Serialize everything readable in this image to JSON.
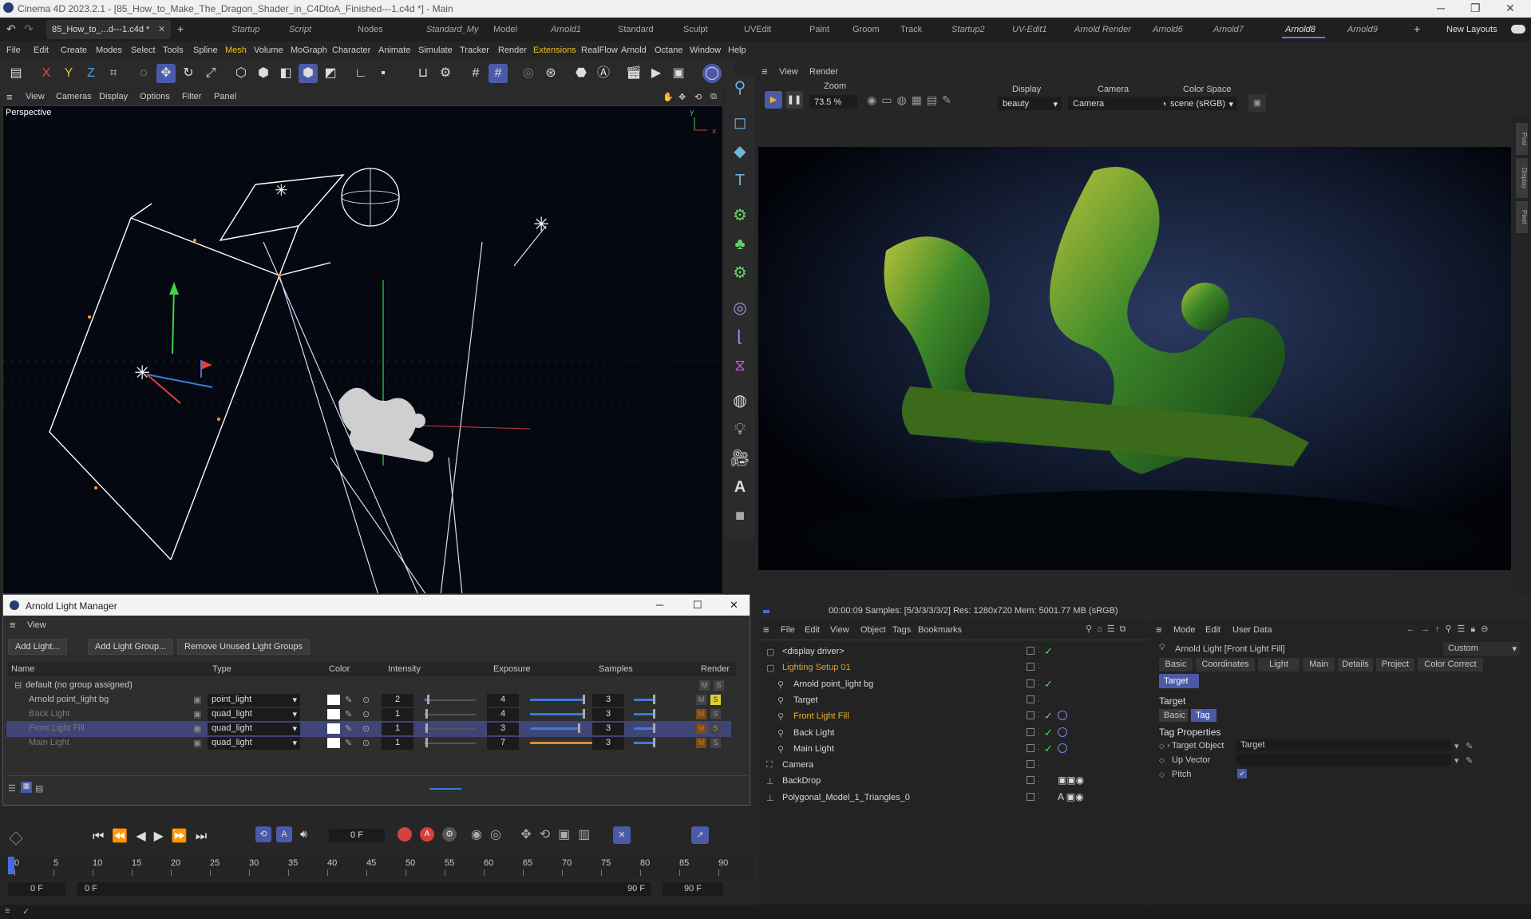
{
  "window": {
    "title": "Cinema 4D 2023.2.1 - [85_How_to_Make_The_Dragon_Shader_in_C4DtoA_Finished---1.c4d *] - Main"
  },
  "tabs": {
    "doc": "85_How_to_...d---1.c4d *",
    "add": "+",
    "layouts": [
      "Startup",
      "Script",
      "Nodes",
      "Standard_My",
      "Model",
      "Arnold1",
      "Standard",
      "Sculpt",
      "UVEdit",
      "Paint",
      "Groom",
      "Track",
      "Startup2",
      "UV-Edit1",
      "Arnold Render",
      "Arnold6",
      "Arnold7",
      "Arnold8",
      "Arnold9"
    ],
    "new_layouts": "New Layouts"
  },
  "menu": [
    "File",
    "Edit",
    "Create",
    "Modes",
    "Select",
    "Tools",
    "Spline",
    "Mesh",
    "Volume",
    "MoGraph",
    "Character",
    "Animate",
    "Simulate",
    "Tracker",
    "Render",
    "Extensions",
    "RealFlow",
    "Arnold",
    "Octane",
    "Window",
    "Help"
  ],
  "viewport_menu": [
    "View",
    "Cameras",
    "Display",
    "Options",
    "Filter",
    "Panel"
  ],
  "viewport": {
    "label": "Perspective"
  },
  "render": {
    "menu": [
      "View",
      "Render"
    ],
    "zoom_label": "Zoom",
    "zoom_value": "73.5 %",
    "display_label": "Display",
    "display_value": "beauty",
    "camera_label": "Camera",
    "camera_value": "Camera",
    "colorspace_label": "Color Space",
    "colorspace_value": "scene (sRGB)",
    "status": "00:00:09  Samples: [5/3/3/3/3/2]  Res: 1280x720  Mem: 5001.77 MB  (sRGB)",
    "side_tabs": [
      "Post",
      "Display",
      "Pixel"
    ]
  },
  "light_manager": {
    "title": "Arnold Light Manager",
    "view": "View",
    "buttons": [
      "Add Light...",
      "Add Light Group...",
      "Remove Unused Light Groups"
    ],
    "columns": [
      "Name",
      "Type",
      "Color",
      "Intensity",
      "Exposure",
      "Samples",
      "Render"
    ],
    "group": "default (no group assigned)",
    "rows": [
      {
        "name": "Arnold point_light bg",
        "type": "point_light",
        "intensity": "2",
        "exposure": "4",
        "samples": "3",
        "expfill": 0.55,
        "intfill": 0.05
      },
      {
        "name": "Back Light",
        "type": "quad_light",
        "intensity": "1",
        "exposure": "4",
        "samples": "3",
        "expfill": 0.55,
        "intfill": 0.02
      },
      {
        "name": "Front Light Fill",
        "type": "quad_light",
        "intensity": "1",
        "exposure": "3",
        "samples": "3",
        "expfill": 0.5,
        "intfill": 0.02
      },
      {
        "name": "Main Light",
        "type": "quad_light",
        "intensity": "1",
        "exposure": "7",
        "samples": "3",
        "expfill": 0.65,
        "intfill": 0.02
      }
    ],
    "m": "M",
    "s": "S"
  },
  "timeline": {
    "frame": "0 F",
    "ticks": [
      "0",
      "5",
      "10",
      "15",
      "20",
      "25",
      "30",
      "35",
      "40",
      "45",
      "50",
      "55",
      "60",
      "65",
      "70",
      "75",
      "80",
      "85",
      "90"
    ],
    "start": "0 F",
    "start2": "0 F",
    "end": "90 F",
    "end2": "90 F"
  },
  "object_manager": {
    "menu": [
      "File",
      "Edit",
      "View",
      "Object",
      "Tags",
      "Bookmarks"
    ],
    "items": [
      {
        "name": "<display driver>",
        "indent": 0,
        "color": "#d8d8d8"
      },
      {
        "name": "Lighting Setup 01",
        "indent": 0,
        "color": "#e0a030"
      },
      {
        "name": "Arnold point_light bg",
        "indent": 1,
        "color": "#d8d8d8"
      },
      {
        "name": "Target",
        "indent": 1,
        "color": "#d8d8d8"
      },
      {
        "name": "Front Light Fill",
        "indent": 1,
        "color": "#f0b020"
      },
      {
        "name": "Back Light",
        "indent": 1,
        "color": "#d8d8d8"
      },
      {
        "name": "Main Light",
        "indent": 1,
        "color": "#d8d8d8"
      },
      {
        "name": "Camera",
        "indent": 0,
        "color": "#d8d8d8"
      },
      {
        "name": "BackDrop",
        "indent": 0,
        "color": "#d8d8d8"
      },
      {
        "name": "Polygonal_Model_1_Triangles_0",
        "indent": 0,
        "color": "#d8d8d8"
      }
    ]
  },
  "attributes": {
    "menu": [
      "Mode",
      "Edit",
      "User Data"
    ],
    "object": "Arnold Light [Front Light Fill]",
    "preset": "Custom",
    "tabs": [
      "Basic",
      "Coordinates",
      "Light",
      "Main",
      "Details",
      "Project",
      "Color Correct"
    ],
    "target_tab": "Target",
    "section": "Target",
    "subtabs": [
      "Basic",
      "Tag"
    ],
    "props_title": "Tag Properties",
    "props": [
      {
        "label": "Target Object",
        "value": "Target"
      },
      {
        "label": "Up Vector",
        "value": ""
      },
      {
        "label": "Pitch",
        "value": ""
      }
    ]
  },
  "colors": {
    "accent": "#4b5aa8",
    "highlight": "#f0b020",
    "check": "#5fd35f"
  }
}
